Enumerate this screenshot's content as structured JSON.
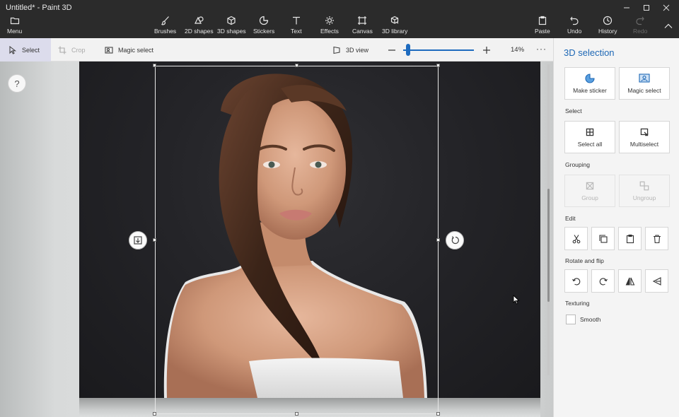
{
  "window": {
    "title": "Untitled* - Paint 3D"
  },
  "ribbon": {
    "menu_label": "Menu",
    "tools": [
      {
        "label": "Brushes",
        "icon": "brush-icon"
      },
      {
        "label": "2D shapes",
        "icon": "2d-shapes-icon"
      },
      {
        "label": "3D shapes",
        "icon": "3d-shapes-icon"
      },
      {
        "label": "Stickers",
        "icon": "stickers-icon"
      },
      {
        "label": "Text",
        "icon": "text-icon"
      },
      {
        "label": "Effects",
        "icon": "effects-icon"
      },
      {
        "label": "Canvas",
        "icon": "canvas-icon"
      },
      {
        "label": "3D library",
        "icon": "3d-library-icon"
      }
    ],
    "paste_label": "Paste",
    "undo_label": "Undo",
    "history_label": "History",
    "redo_label": "Redo"
  },
  "cmdbar": {
    "select_label": "Select",
    "crop_label": "Crop",
    "magic_select_label": "Magic select",
    "view3d_label": "3D view",
    "zoom_value": "14%",
    "zoom_fraction": 0.07,
    "more_label": "···"
  },
  "canvas": {
    "help_label": "?"
  },
  "panel": {
    "title": "3D selection",
    "make_sticker_label": "Make sticker",
    "magic_select_label": "Magic select",
    "select_section": "Select",
    "select_all_label": "Select all",
    "multiselect_label": "Multiselect",
    "grouping_section": "Grouping",
    "group_label": "Group",
    "ungroup_label": "Ungroup",
    "edit_section": "Edit",
    "rotate_section": "Rotate and flip",
    "texturing_section": "Texturing",
    "smooth_label": "Smooth"
  }
}
